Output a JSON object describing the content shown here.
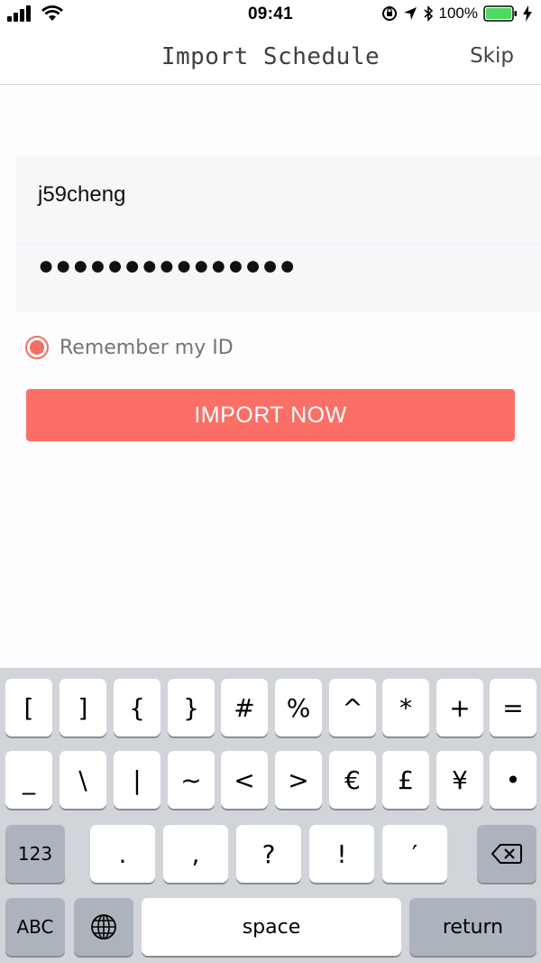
{
  "status_bar": {
    "time": "09:41",
    "battery_percent": "100%"
  },
  "nav": {
    "title": "Import Schedule",
    "skip_label": "Skip"
  },
  "form": {
    "username": "j59cheng",
    "password_masked": "●●●●●●●●●●●●●●●",
    "remember_label": "Remember my ID",
    "remember_checked": true,
    "import_button_label": "IMPORT NOW"
  },
  "colors": {
    "accent": "#fb6f66",
    "keyboard_bg": "#d1d4d9"
  },
  "keyboard": {
    "row1": [
      "[",
      "]",
      "{",
      "}",
      "#",
      "%",
      "^",
      "*",
      "+",
      "="
    ],
    "row2": [
      "_",
      "\\",
      "|",
      "~",
      "<",
      ">",
      "€",
      "£",
      "¥",
      "•"
    ],
    "row3": {
      "mode_key": "123",
      "keys": [
        ".",
        ",",
        "?",
        "!",
        "′"
      ],
      "delete_icon": "backspace-icon"
    },
    "row4": {
      "abc_key": "ABC",
      "globe_icon": "globe-icon",
      "space_label": "space",
      "return_label": "return"
    }
  }
}
